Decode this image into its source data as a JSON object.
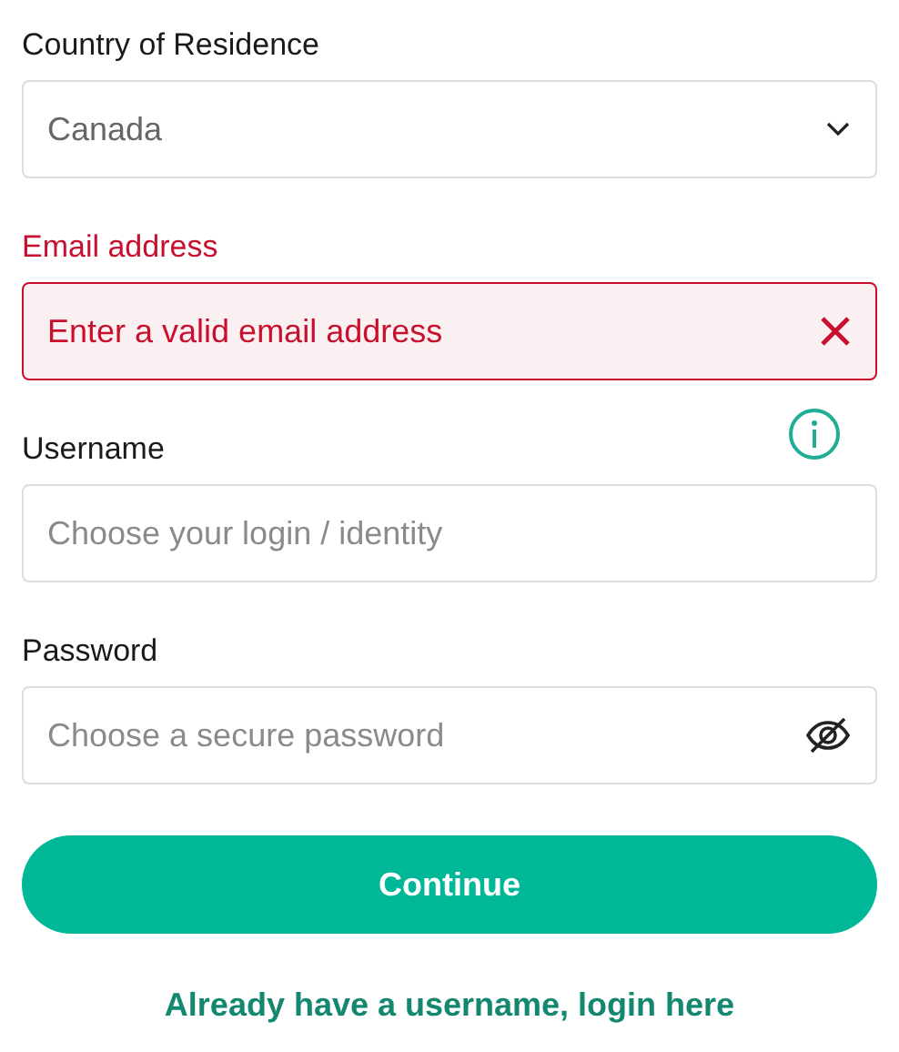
{
  "fields": [
    {
      "kind": "select",
      "label": "Country of Residence",
      "value": "Canada",
      "error": false
    },
    {
      "kind": "email",
      "label": "Email address",
      "placeholder": "Enter a valid email address",
      "error": true
    },
    {
      "kind": "text",
      "label": "Username",
      "placeholder": "Choose your login / identity",
      "error": false,
      "info": true
    },
    {
      "kind": "password",
      "label": "Password",
      "placeholder": "Choose a secure password",
      "error": false
    }
  ],
  "submit": "Continue",
  "login_link": "Already have a username, login here"
}
